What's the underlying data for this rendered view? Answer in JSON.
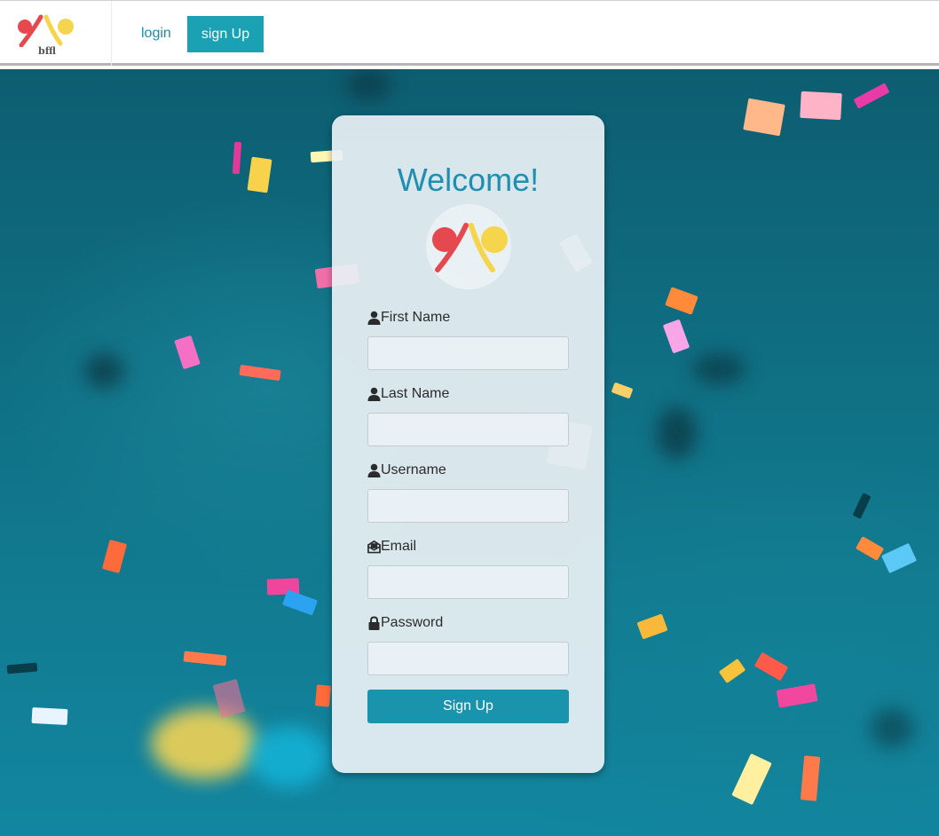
{
  "brand": {
    "name": "bffl"
  },
  "nav": {
    "login": "login",
    "signup": "sign Up"
  },
  "form": {
    "title": "Welcome!",
    "fields": [
      {
        "label": "First Name",
        "icon": "user-icon",
        "value": "",
        "placeholder": ""
      },
      {
        "label": "Last Name",
        "icon": "user-icon",
        "value": "",
        "placeholder": ""
      },
      {
        "label": "Username",
        "icon": "user-icon",
        "value": "",
        "placeholder": ""
      },
      {
        "label": "Email",
        "icon": "envelope-open-icon",
        "value": "",
        "placeholder": ""
      },
      {
        "label": "Password",
        "icon": "lock-icon",
        "value": "",
        "placeholder": ""
      }
    ],
    "submit": "Sign Up"
  },
  "colors": {
    "accent": "#1ba1b4",
    "title": "#1e8fb0",
    "logo_red": "#e6484f",
    "logo_yellow": "#f5d54b",
    "background": "#0f6b7f"
  }
}
